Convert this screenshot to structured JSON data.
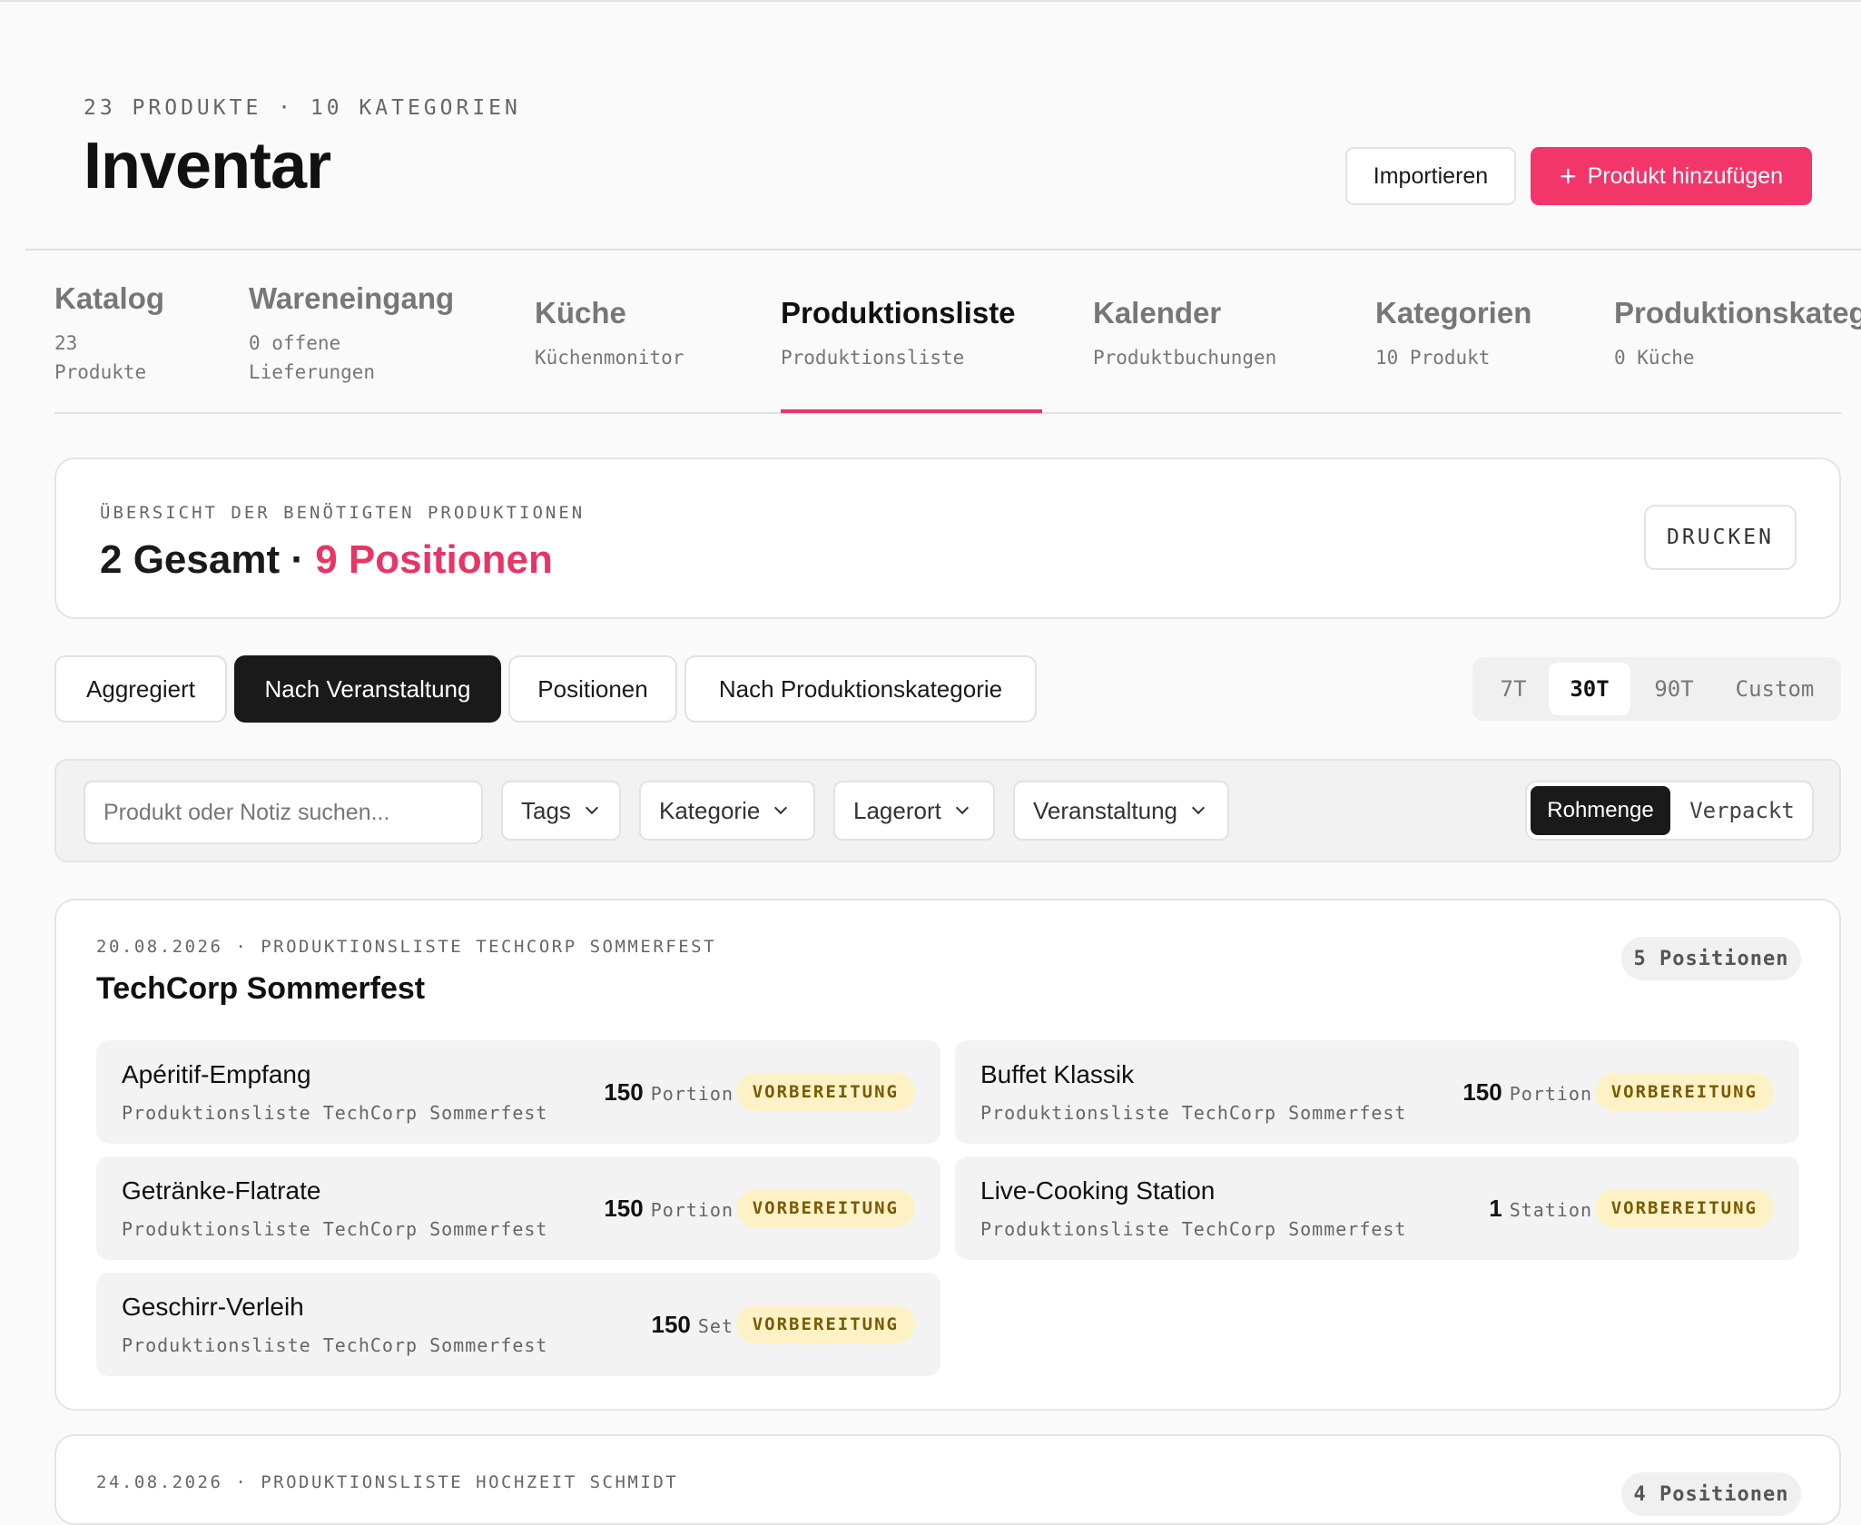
{
  "header": {
    "meta": "23 PRODUKTE · 10 KATEGORIEN",
    "title": "Inventar",
    "import_label": "Importieren",
    "add_label": "Produkt hinzufügen"
  },
  "tabs": [
    {
      "label": "Katalog",
      "sub": "23\nProdukte"
    },
    {
      "label": "Wareneingang",
      "sub": "0 offene\nLieferungen"
    },
    {
      "label": "Küche",
      "sub": "Küchenmonitor"
    },
    {
      "label": "Produktionsliste",
      "sub": "Produktionsliste",
      "active": true
    },
    {
      "label": "Kalender",
      "sub": "Produktbuchungen"
    },
    {
      "label": "Kategorien",
      "sub": "10 Produkt"
    },
    {
      "label": "Produktionskategorien",
      "sub": "0 Küche"
    }
  ],
  "summary": {
    "label": "ÜBERSICHT DER BENÖTIGTEN PRODUKTIONEN",
    "total": "2 Gesamt",
    "separator": "·",
    "positions": "9 Positionen",
    "print_label": "DRUCKEN"
  },
  "views": [
    {
      "label": "Aggregiert"
    },
    {
      "label": "Nach Veranstaltung",
      "active": true
    },
    {
      "label": "Positionen"
    },
    {
      "label": "Nach Produktionskategorie"
    }
  ],
  "ranges": [
    {
      "label": "7T"
    },
    {
      "label": "30T",
      "active": true
    },
    {
      "label": "90T"
    },
    {
      "label": "Custom"
    }
  ],
  "filters": {
    "search_placeholder": "Produkt oder Notiz suchen...",
    "dropdowns": [
      "Tags",
      "Kategorie",
      "Lagerort",
      "Veranstaltung"
    ],
    "units": [
      {
        "label": "Rohmenge",
        "active": true
      },
      {
        "label": "Verpackt"
      }
    ]
  },
  "events": [
    {
      "meta": "20.08.2026 · PRODUKTIONSLISTE TECHCORP SOMMERFEST",
      "title": "TechCorp Sommerfest",
      "badge": "5 Positionen",
      "items": [
        {
          "name": "Apéritif-Empfang",
          "sub": "Produktionsliste TechCorp Sommerfest",
          "qty": "150",
          "unit": "Portion",
          "status": "VORBEREITUNG"
        },
        {
          "name": "Buffet Klassik",
          "sub": "Produktionsliste TechCorp Sommerfest",
          "qty": "150",
          "unit": "Portion",
          "status": "VORBEREITUNG"
        },
        {
          "name": "Getränke-Flatrate",
          "sub": "Produktionsliste TechCorp Sommerfest",
          "qty": "150",
          "unit": "Portion",
          "status": "VORBEREITUNG"
        },
        {
          "name": "Live-Cooking Station",
          "sub": "Produktionsliste TechCorp Sommerfest",
          "qty": "1",
          "unit": "Station",
          "status": "VORBEREITUNG"
        },
        {
          "name": "Geschirr-Verleih",
          "sub": "Produktionsliste TechCorp Sommerfest",
          "qty": "150",
          "unit": "Set",
          "status": "VORBEREITUNG"
        }
      ]
    },
    {
      "meta": "24.08.2026 · PRODUKTIONSLISTE HOCHZEIT SCHMIDT",
      "title": "",
      "badge": "4 Positionen",
      "items": []
    }
  ],
  "colors": {
    "accent": "#e73565",
    "primary_button": "#f2366a",
    "status_bg": "#fdf2c6",
    "status_text": "#7a5a00",
    "dark": "#1a1a1a"
  }
}
